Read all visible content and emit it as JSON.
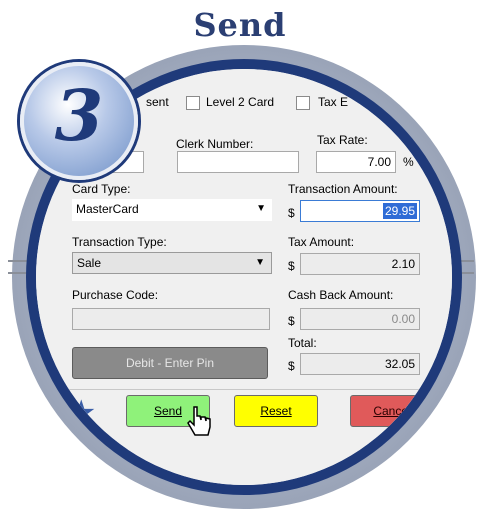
{
  "heading": "Send",
  "step_number": "3",
  "options": {
    "card_present_label": "sent",
    "level2_label": "Level 2 Card",
    "tax_exempt_label": "Tax E"
  },
  "fields": {
    "number_label": "#:",
    "clerk_label": "Clerk Number:",
    "tax_rate_label": "Tax Rate:",
    "tax_rate_value": "7.00",
    "percent": "%",
    "card_type_label": "Card Type:",
    "card_type_value": "MasterCard",
    "transaction_amount_label": "Transaction Amount:",
    "transaction_amount_value": "29.95",
    "transaction_type_label": "Transaction Type:",
    "transaction_type_value": "Sale",
    "tax_amount_label": "Tax Amount:",
    "tax_amount_value": "2.10",
    "purchase_code_label": "Purchase Code:",
    "cash_back_label": "Cash Back Amount:",
    "cash_back_value": "0.00",
    "total_label": "Total:",
    "total_value": "32.05",
    "currency": "$"
  },
  "buttons": {
    "debit": "Debit - Enter Pin",
    "send": "Send",
    "reset": "Reset",
    "cancel": "Cancel"
  },
  "colors": {
    "send_bg": "#8ff27a",
    "reset_bg": "#ffff00",
    "cancel_bg": "#e05a5a",
    "ring": "#1f3a7a"
  }
}
